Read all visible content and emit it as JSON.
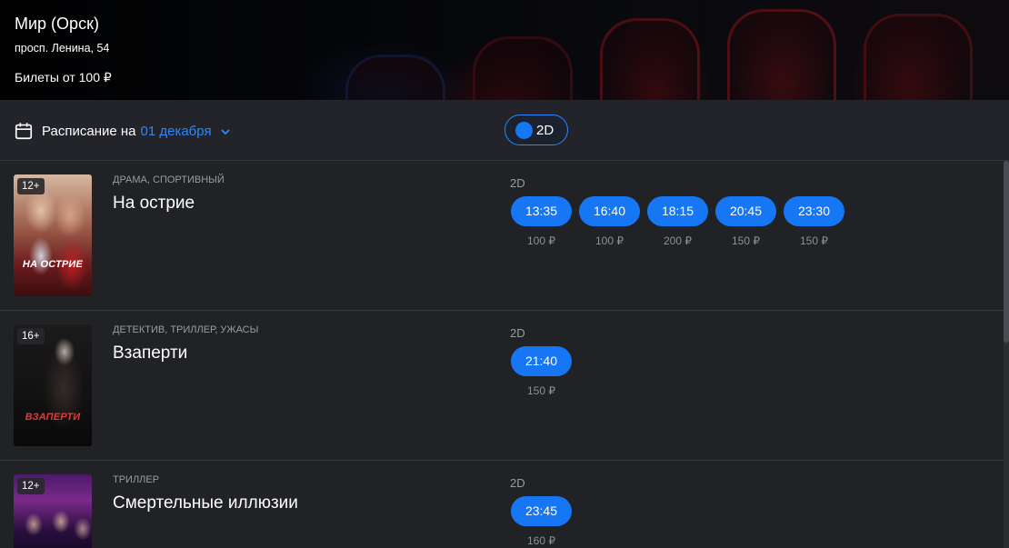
{
  "cinema": {
    "name": "Мир (Орск)",
    "address": "просп. Ленина, 54",
    "tickets_from": "Билеты от 100 ₽"
  },
  "toolbar": {
    "schedule_label": "Расписание на",
    "selected_date": "01 декабря",
    "format_filter": "2D",
    "icons": {
      "calendar": "calendar-icon",
      "chevron": "chevron-down-icon"
    }
  },
  "colors": {
    "accent": "#1676f3",
    "link": "#2f86ff",
    "background": "#202226",
    "muted_text": "#9a9ca1"
  },
  "movies": [
    {
      "age": "12+",
      "poster_caption": "НА ОСТРИЕ",
      "genres": "ДРАМА, СПОРТИВНЫЙ",
      "title": "На острие",
      "format": "2D",
      "sessions": [
        {
          "time": "13:35",
          "price": "100 ₽"
        },
        {
          "time": "16:40",
          "price": "100 ₽"
        },
        {
          "time": "18:15",
          "price": "200 ₽"
        },
        {
          "time": "20:45",
          "price": "150 ₽"
        },
        {
          "time": "23:30",
          "price": "150 ₽"
        }
      ]
    },
    {
      "age": "16+",
      "poster_caption": "ВЗАПЕРТИ",
      "genres": "ДЕТЕКТИВ, ТРИЛЛЕР, УЖАСЫ",
      "title": "Взаперти",
      "format": "2D",
      "sessions": [
        {
          "time": "21:40",
          "price": "150 ₽"
        }
      ]
    },
    {
      "age": "12+",
      "poster_caption": "",
      "genres": "ТРИЛЛЕР",
      "title": "Смертельные иллюзии",
      "format": "2D",
      "sessions": [
        {
          "time": "23:45",
          "price": "160 ₽"
        }
      ]
    }
  ]
}
